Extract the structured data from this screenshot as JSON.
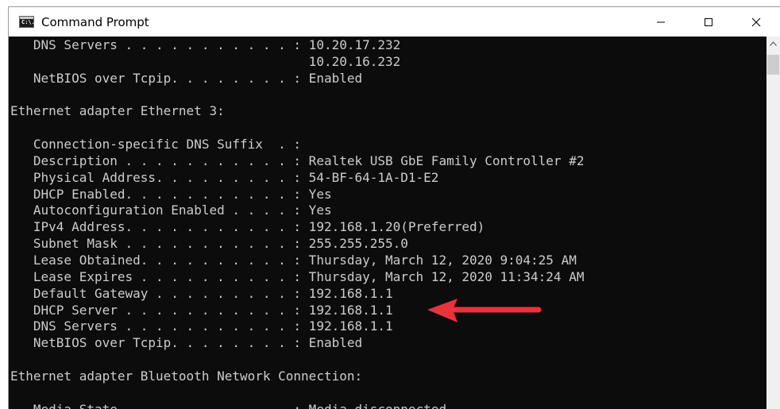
{
  "window": {
    "title": "Command Prompt",
    "icon_label": "C:\\."
  },
  "controls": [
    "minimize-icon",
    "maximize-icon",
    "close-icon"
  ],
  "console": {
    "lines": [
      "   DNS Servers . . . . . . . . . . . : 10.20.17.232",
      "                                       10.20.16.232",
      "   NetBIOS over Tcpip. . . . . . . . : Enabled",
      "",
      "Ethernet adapter Ethernet 3:",
      "",
      "   Connection-specific DNS Suffix  . :",
      "   Description . . . . . . . . . . . : Realtek USB GbE Family Controller #2",
      "   Physical Address. . . . . . . . . : 54-BF-64-1A-D1-E2",
      "   DHCP Enabled. . . . . . . . . . . : Yes",
      "   Autoconfiguration Enabled . . . . : Yes",
      "   IPv4 Address. . . . . . . . . . . : 192.168.1.20(Preferred)",
      "   Subnet Mask . . . . . . . . . . . : 255.255.255.0",
      "   Lease Obtained. . . . . . . . . . : Thursday, March 12, 2020 9:04:25 AM",
      "   Lease Expires . . . . . . . . . . : Thursday, March 12, 2020 11:34:24 AM",
      "   Default Gateway . . . . . . . . . : 192.168.1.1",
      "   DHCP Server . . . . . . . . . . . : 192.168.1.1",
      "   DNS Servers . . . . . . . . . . . : 192.168.1.1",
      "   NetBIOS over Tcpip. . . . . . . . : Enabled",
      "",
      "Ethernet adapter Bluetooth Network Connection:",
      "",
      "   Media State . . . . . . . . . . . : Media disconnected"
    ],
    "text_color": "#cccccc",
    "background": "#0c0c0c"
  },
  "annotation": {
    "color": "#e8323c",
    "points_to_line": "DHCP Server"
  }
}
